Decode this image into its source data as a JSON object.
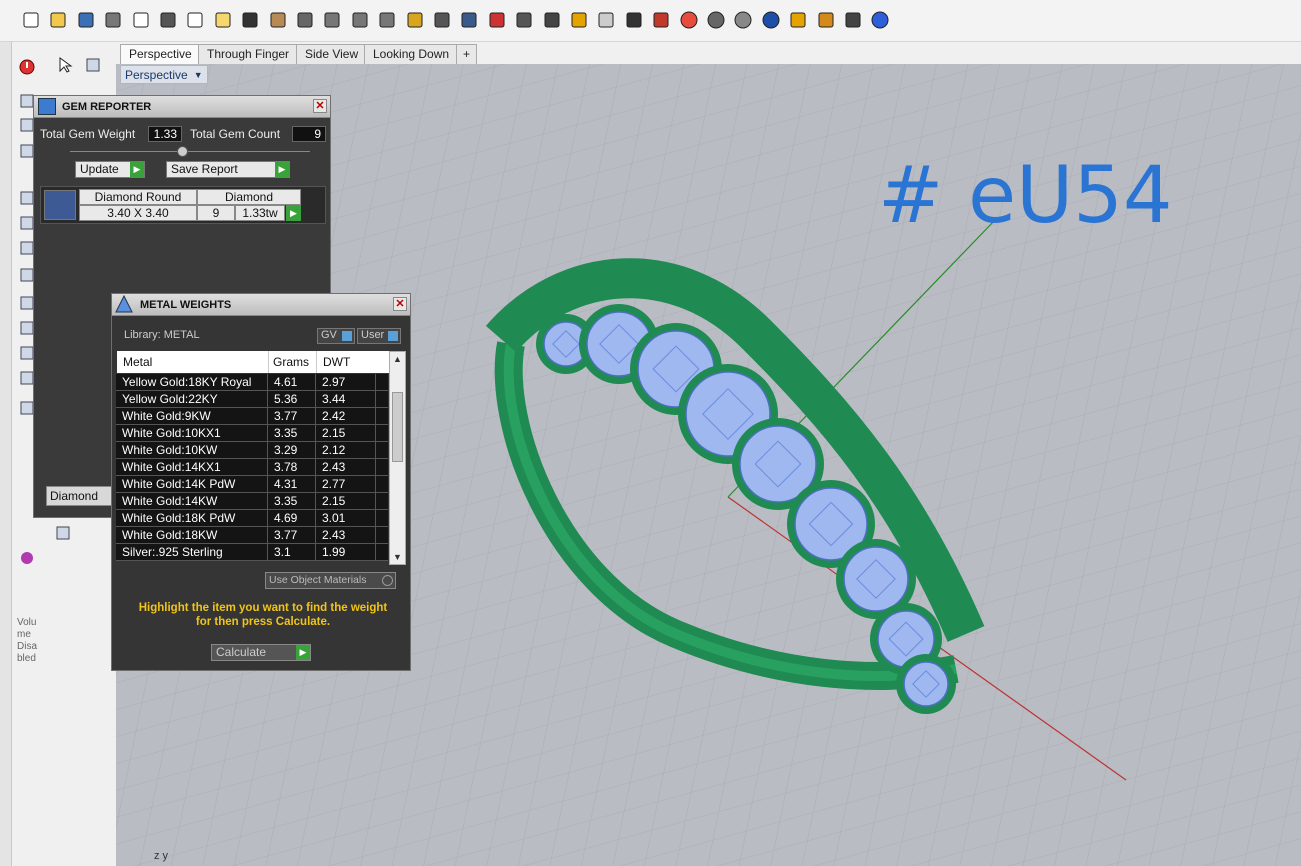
{
  "viewport_tabs": [
    "Perspective",
    "Through Finger",
    "Side View",
    "Looking Down"
  ],
  "viewport_label": "Perspective",
  "annotation": "# eU54",
  "gem_reporter": {
    "title": "GEM REPORTER",
    "total_weight_label": "Total Gem Weight",
    "total_weight_value": "1.33",
    "total_count_label": "Total Gem Count",
    "total_count_value": "9",
    "update_label": "Update",
    "save_label": "Save Report",
    "row": {
      "shape": "Diamond Round",
      "type": "Diamond",
      "size": "3.40 X 3.40",
      "count": "9",
      "weight": "1.33tw"
    },
    "footer_label": "Diamond",
    "footer_extra": "("
  },
  "metal_weights": {
    "title": "METAL WEIGHTS",
    "library_label": "Library: METAL",
    "gv_label": "GV",
    "user_label": "User",
    "columns": [
      "Metal",
      "Grams",
      "DWT"
    ],
    "rows": [
      [
        "Yellow Gold:18KY Royal",
        "4.61",
        "2.97"
      ],
      [
        "Yellow Gold:22KY",
        "5.36",
        "3.44"
      ],
      [
        "White Gold:9KW",
        "3.77",
        "2.42"
      ],
      [
        "White Gold:10KX1",
        "3.35",
        "2.15"
      ],
      [
        "White Gold:10KW",
        "3.29",
        "2.12"
      ],
      [
        "White Gold:14KX1",
        "3.78",
        "2.43"
      ],
      [
        "White Gold:14K PdW",
        "4.31",
        "2.77"
      ],
      [
        "White Gold:14KW",
        "3.35",
        "2.15"
      ],
      [
        "White Gold:18K PdW",
        "4.69",
        "3.01"
      ],
      [
        "White Gold:18KW",
        "3.77",
        "2.43"
      ],
      [
        "Silver:.925 Sterling",
        "3.1",
        "1.99"
      ]
    ],
    "use_object_label": "Use Object Materials",
    "note_line1": "Highlight the item you want to find the weight",
    "note_line2": "for then press Calculate.",
    "calculate_label": "Calculate"
  },
  "sidebar_text": "Volume Disabled",
  "axis_label": "z y"
}
